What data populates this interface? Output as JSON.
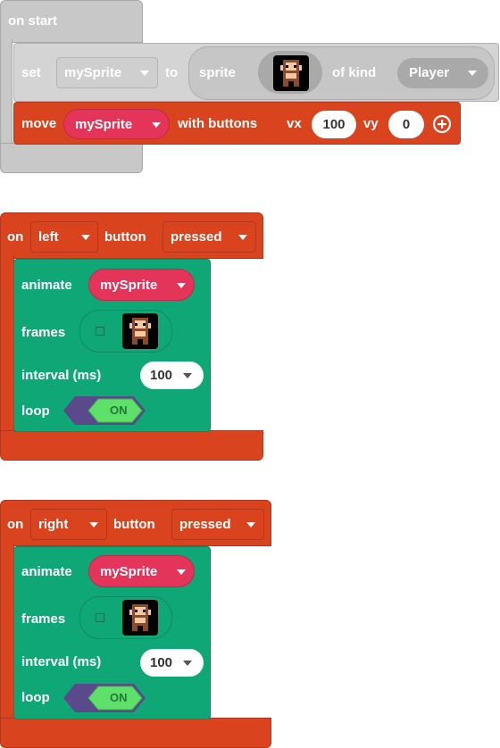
{
  "on_start": {
    "header": "on start",
    "set": {
      "label_set": "set",
      "variable": "mySprite",
      "label_to": "to",
      "label_sprite": "sprite",
      "label_of_kind": "of kind",
      "kind": "Player"
    },
    "move": {
      "label_move": "move",
      "variable": "mySprite",
      "label_with_buttons": "with buttons",
      "label_vx": "vx",
      "vx": "100",
      "label_vy": "vy",
      "vy": "0",
      "add_icon": "plus-circle-icon"
    }
  },
  "left_handler": {
    "label_on": "on",
    "button": "left",
    "label_button": "button",
    "event": "pressed",
    "animate": {
      "label_animate": "animate",
      "variable": "mySprite",
      "label_frames": "frames",
      "label_interval": "interval (ms)",
      "interval": "100",
      "label_loop": "loop",
      "loop": "ON"
    }
  },
  "right_handler": {
    "label_on": "on",
    "button": "right",
    "label_button": "button",
    "event": "pressed",
    "animate": {
      "label_animate": "animate",
      "variable": "mySprite",
      "label_frames": "frames",
      "label_interval": "interval (ms)",
      "interval": "100",
      "label_loop": "loop",
      "loop": "ON"
    }
  },
  "colors": {
    "loops_gray": "#c8c8c8",
    "controller_red": "#d9431e",
    "variable_pink": "#e5345a",
    "animation_green": "#10a776",
    "logic_purple": "#5b4a8b",
    "toggle_green": "#5fe06b"
  }
}
